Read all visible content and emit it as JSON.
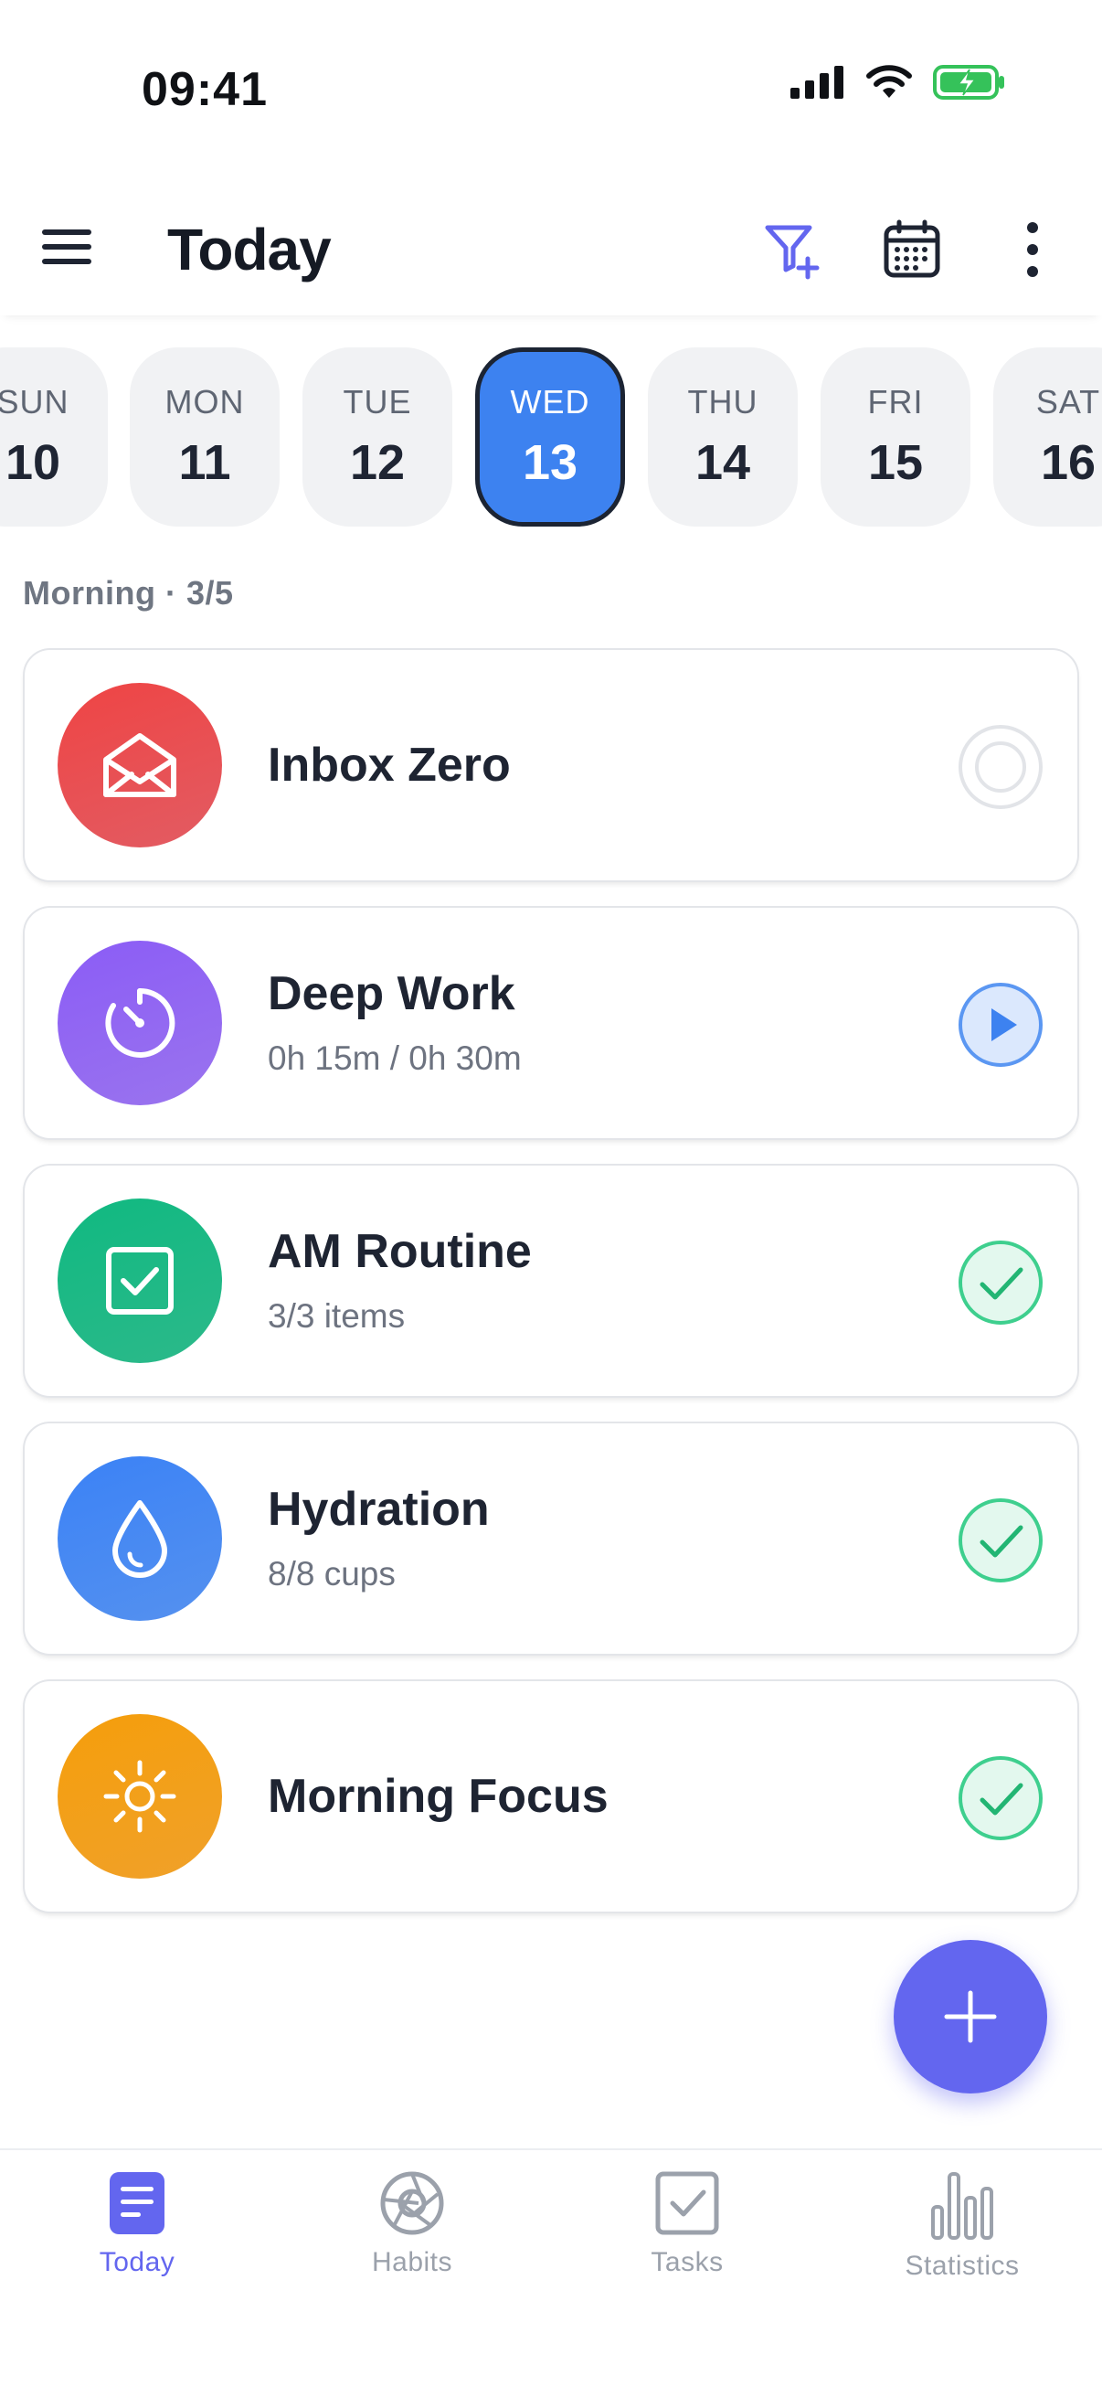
{
  "status_bar": {
    "time": "09:41"
  },
  "header": {
    "title": "Today"
  },
  "colors": {
    "accent": "#6366ef",
    "selected_day": "#3d82f0",
    "done": "#3ecf8e",
    "inbox": "#e94b4f",
    "deep_work": "#8b5cf6",
    "am_routine": "#1fb07e",
    "hydration": "#3d82f0",
    "morning_focus": "#f29a1a"
  },
  "days": [
    {
      "dow": "SUN",
      "num": "10"
    },
    {
      "dow": "MON",
      "num": "11"
    },
    {
      "dow": "TUE",
      "num": "12"
    },
    {
      "dow": "WED",
      "num": "13",
      "selected": true
    },
    {
      "dow": "THU",
      "num": "14"
    },
    {
      "dow": "FRI",
      "num": "15"
    },
    {
      "dow": "SAT",
      "num": "16"
    }
  ],
  "section": {
    "label": "Morning · 3/5"
  },
  "habits": [
    {
      "name": "Inbox Zero",
      "subtitle": "",
      "icon": "envelope-icon",
      "state": "not-started"
    },
    {
      "name": "Deep Work",
      "subtitle": "0h 15m / 0h 30m",
      "icon": "timer-icon",
      "state": "play"
    },
    {
      "name": "AM Routine",
      "subtitle": "3/3 items",
      "icon": "checkbox-icon",
      "state": "done"
    },
    {
      "name": "Hydration",
      "subtitle": "8/8 cups",
      "icon": "water-drop-icon",
      "state": "done"
    },
    {
      "name": "Morning Focus",
      "subtitle": "",
      "icon": "sun-icon",
      "state": "done"
    }
  ],
  "nav": [
    {
      "label": "Today",
      "icon": "today-icon",
      "active": true
    },
    {
      "label": "Habits",
      "icon": "habits-icon",
      "active": false
    },
    {
      "label": "Tasks",
      "icon": "tasks-icon",
      "active": false
    },
    {
      "label": "Statistics",
      "icon": "statistics-icon",
      "active": false
    }
  ]
}
